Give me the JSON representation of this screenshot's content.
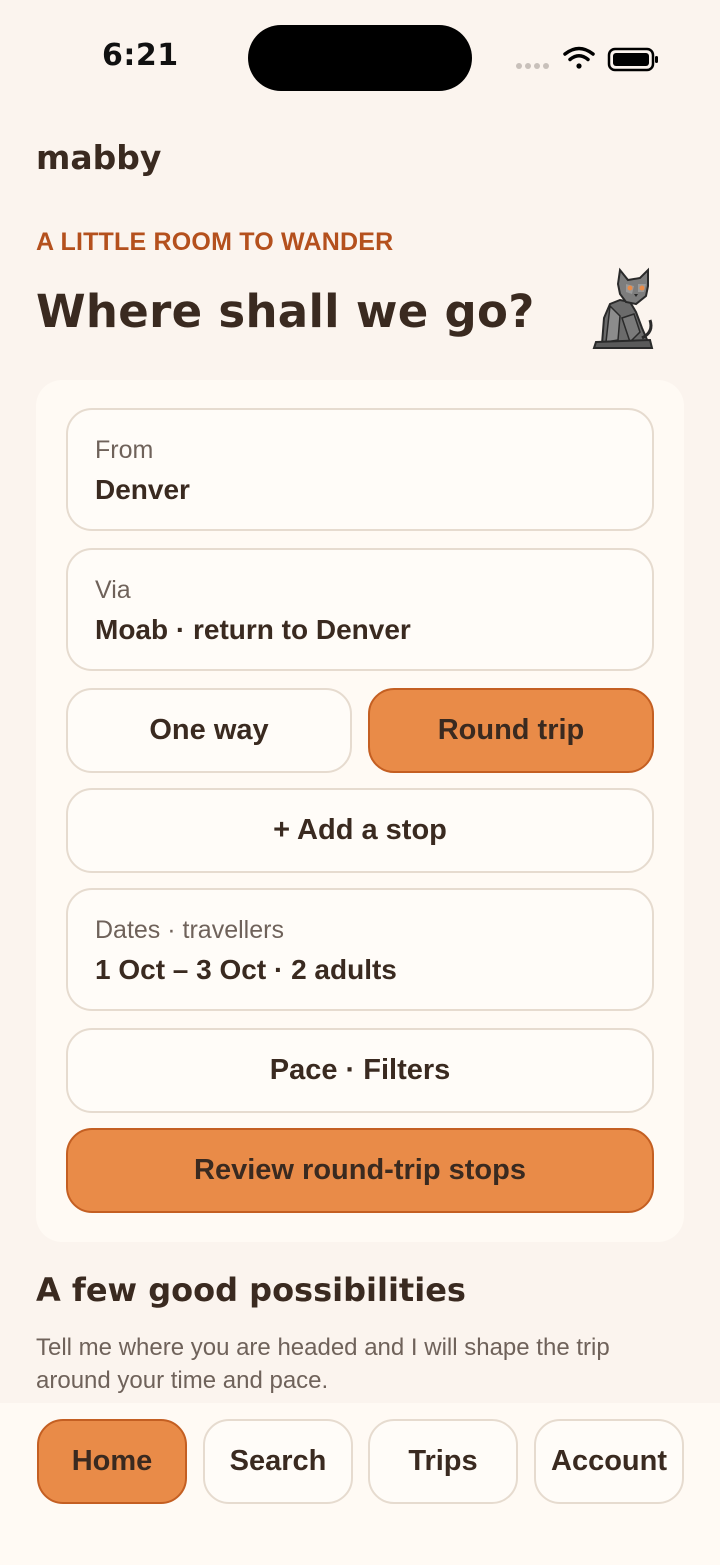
{
  "status_bar": {
    "time": "6:21",
    "icons": [
      "signal-dots-icon",
      "wifi-icon",
      "battery-icon"
    ]
  },
  "app": {
    "brand": "mabby",
    "eyebrow": "A LITTLE ROOM TO WANDER",
    "headline": "Where shall we go?",
    "mascot_icon": "cat-icon"
  },
  "form": {
    "from": {
      "label": "From",
      "value": "Denver"
    },
    "via": {
      "label": "Via",
      "value": "Moab · return to Denver"
    },
    "trip_type": {
      "options": [
        "One way",
        "Round trip"
      ],
      "selected": "Round trip"
    },
    "add_stop_label": "+ Add a stop",
    "dates": {
      "label": "Dates · travellers",
      "value": "1 Oct – 3 Oct · 2 adults"
    },
    "pace_filters_label": "Pace · Filters",
    "submit_label": "Review round-trip stops"
  },
  "possibilities": {
    "title": "A few good possibilities",
    "body": "Tell me where you are headed and I will shape the trip around your time and pace."
  },
  "tabs": {
    "items": [
      "Home",
      "Search",
      "Trips",
      "Account"
    ],
    "active": "Home"
  },
  "colors": {
    "background": "#fbf4ee",
    "accent": "#e98b48",
    "accent_border": "#c45f22",
    "eyebrow": "#b4501d",
    "text": "#3a2a20",
    "muted": "#6f625a"
  }
}
